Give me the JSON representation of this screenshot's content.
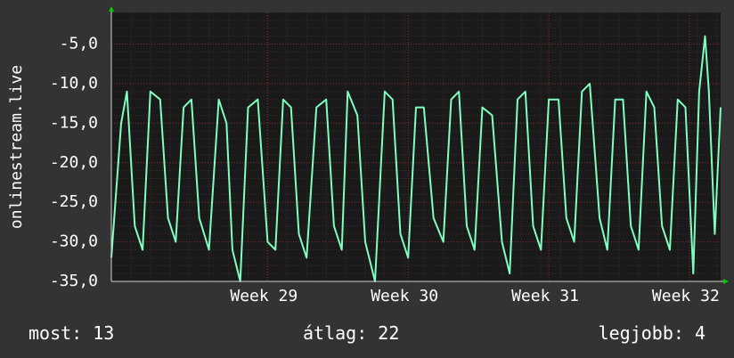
{
  "chart_data": {
    "type": "line",
    "ylabel": "onlinestream.live",
    "ylim": [
      -35,
      -1
    ],
    "yticks": [
      "-5,0",
      "-10,0",
      "-15,0",
      "-20,0",
      "-25,0",
      "-30,0",
      "-35,0"
    ],
    "ytick_values": [
      -5,
      -10,
      -15,
      -20,
      -25,
      -30,
      -35
    ],
    "x_ticks": [
      "Week 29",
      "Week 30",
      "Week 31",
      "Week 32"
    ],
    "x_tick_values": [
      8.0,
      15.2,
      22.4,
      29.6
    ],
    "xlim": [
      0,
      31.2
    ],
    "grid": true,
    "series": [
      {
        "color": "#7fffbf",
        "x": [
          0,
          0.5,
          0.8,
          1.2,
          1.6,
          2.0,
          2.5,
          2.9,
          3.3,
          3.7,
          4.1,
          4.5,
          5.0,
          5.5,
          5.9,
          6.2,
          6.6,
          7.0,
          7.5,
          8.0,
          8.4,
          8.8,
          9.2,
          9.6,
          10.0,
          10.5,
          11.0,
          11.4,
          11.8,
          12.1,
          12.6,
          13.0,
          13.5,
          14.0,
          14.4,
          14.8,
          15.2,
          15.6,
          16.0,
          16.5,
          17.0,
          17.4,
          17.8,
          18.2,
          18.6,
          19.0,
          19.5,
          20.0,
          20.4,
          20.8,
          21.2,
          21.6,
          22.0,
          22.4,
          22.9,
          23.3,
          23.7,
          24.1,
          24.5,
          25.0,
          25.4,
          25.8,
          26.2,
          26.6,
          27.0,
          27.4,
          27.8,
          28.2,
          28.6,
          29.0,
          29.4,
          29.8,
          30.1,
          30.4,
          30.6,
          30.9,
          31.2
        ],
        "y": [
          -32,
          -15,
          -11,
          -28,
          -31,
          -11,
          -12,
          -27,
          -30,
          -13,
          -12,
          -27,
          -31,
          -12,
          -15,
          -31,
          -35,
          -13,
          -12,
          -30,
          -31,
          -12,
          -13,
          -29,
          -32,
          -13,
          -12,
          -28,
          -31,
          -11,
          -14,
          -30,
          -35,
          -11,
          -12,
          -29,
          -32,
          -13,
          -13,
          -27,
          -30,
          -12,
          -11,
          -28,
          -31,
          -13,
          -14,
          -30,
          -34,
          -12,
          -11,
          -28,
          -31,
          -12,
          -12,
          -27,
          -30,
          -11,
          -10,
          -27,
          -31,
          -12,
          -12,
          -28,
          -31,
          -11,
          -13,
          -28,
          -31,
          -12,
          -13,
          -34,
          -11,
          -4,
          -11,
          -29,
          -13
        ]
      }
    ]
  },
  "footer": {
    "current": "most: 13",
    "average": "átlag: 22",
    "best": "legjobb: 4"
  },
  "colors": {
    "background": "#333333",
    "plot_background": "#1a1a1a",
    "grid": "#8b2e2e",
    "line": "#7fffbf",
    "arrow": "#00cc00"
  }
}
